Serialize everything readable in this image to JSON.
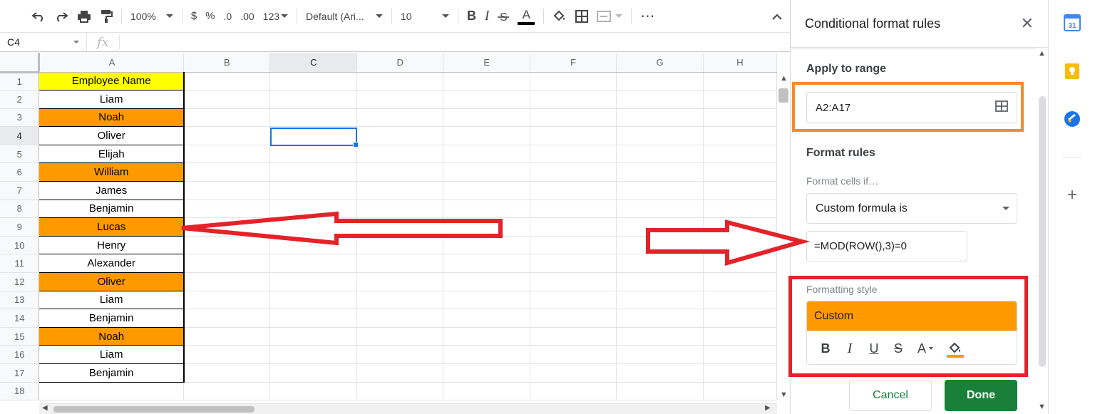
{
  "toolbar": {
    "zoom": "100%",
    "currency": "$",
    "percent": "%",
    "decrease_decimals": ".0",
    "increase_decimals": ".00",
    "more_formats": "123",
    "font": "Default (Ari...",
    "font_size": "10",
    "bold": "B",
    "italic": "I",
    "text_color": "A"
  },
  "formula_bar": {
    "name_box": "C4",
    "fx": "fx"
  },
  "sheet": {
    "columns": [
      "A",
      "B",
      "C",
      "D",
      "E",
      "F",
      "G",
      "H"
    ],
    "selected_column": "C",
    "selected_row": 4,
    "rows": [
      {
        "num": "1",
        "a": "Employee Name",
        "style": "hdr"
      },
      {
        "num": "2",
        "a": "Liam",
        "style": "plain"
      },
      {
        "num": "3",
        "a": "Noah",
        "style": "hl"
      },
      {
        "num": "4",
        "a": "Oliver",
        "style": "plain"
      },
      {
        "num": "5",
        "a": "Elijah",
        "style": "plain"
      },
      {
        "num": "6",
        "a": "William",
        "style": "hl"
      },
      {
        "num": "7",
        "a": "James",
        "style": "plain"
      },
      {
        "num": "8",
        "a": "Benjamin",
        "style": "plain"
      },
      {
        "num": "9",
        "a": "Lucas",
        "style": "hl"
      },
      {
        "num": "10",
        "a": "Henry",
        "style": "plain"
      },
      {
        "num": "11",
        "a": "Alexander",
        "style": "plain"
      },
      {
        "num": "12",
        "a": "Oliver",
        "style": "hl"
      },
      {
        "num": "13",
        "a": "Liam",
        "style": "plain"
      },
      {
        "num": "14",
        "a": "Benjamin",
        "style": "plain"
      },
      {
        "num": "15",
        "a": "Noah",
        "style": "hl"
      },
      {
        "num": "16",
        "a": "Liam",
        "style": "plain"
      },
      {
        "num": "17",
        "a": "Benjamin",
        "style": "plain"
      },
      {
        "num": "18",
        "a": "",
        "style": "empty"
      }
    ]
  },
  "panel": {
    "title": "Conditional format rules",
    "apply_to_range_label": "Apply to range",
    "range_value": "A2:A17",
    "format_rules_label": "Format rules",
    "format_cells_if_label": "Format cells if…",
    "condition": "Custom formula is",
    "formula_value": "=MOD(ROW(),3)=0",
    "formatting_style_label": "Formatting style",
    "style_preview_text": "Custom",
    "style_tools": {
      "bold": "B",
      "italic": "I",
      "underline": "U",
      "strike": "S",
      "text_color": "A"
    },
    "cancel_label": "Cancel",
    "done_label": "Done"
  },
  "rail": {
    "calendar_day": "31"
  },
  "colors": {
    "highlight_orange": "#ff9900",
    "header_yellow": "#ffff00",
    "done_green": "#188038",
    "annotation_red": "#e52229",
    "annotation_orange": "#f58a2e",
    "selection_blue": "#1a73e8"
  }
}
